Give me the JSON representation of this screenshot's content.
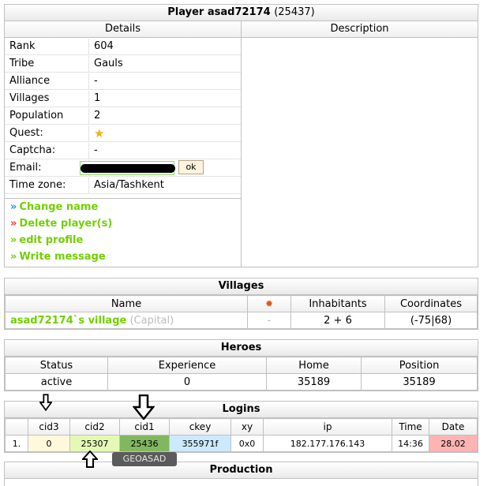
{
  "player": {
    "title": "Player asad72174",
    "id_text": "(25437)",
    "details_header": "Details",
    "description_header": "Description",
    "rows": [
      {
        "label": "Rank",
        "value": "604"
      },
      {
        "label": "Tribe",
        "value": "Gauls"
      },
      {
        "label": "Alliance",
        "value": "-"
      },
      {
        "label": "Villages",
        "value": "1"
      },
      {
        "label": "Population",
        "value": "2"
      },
      {
        "label": "Quest:",
        "value": ""
      },
      {
        "label": "Captcha:",
        "value": "-"
      },
      {
        "label": "Email:",
        "value": ""
      },
      {
        "label": "Time zone:",
        "value": "Asia/Tashkent"
      }
    ],
    "email_button": "ok",
    "links": [
      {
        "arrow": "»",
        "label": "Change name"
      },
      {
        "arrow": "»",
        "label": "Delete player(s)"
      },
      {
        "arrow": "»",
        "label": "edit profile"
      },
      {
        "arrow": "»",
        "label": "Write message"
      }
    ],
    "quest_icon": "star-icon",
    "colors": {
      "link_green": "#71d000",
      "arrow_blue": "#1f9bd6",
      "arrow_red": "#e33333"
    }
  },
  "villages": {
    "title": "Villages",
    "headers": {
      "name": "Name",
      "inhabitants": "Inhabitants",
      "coordinates": "Coordinates"
    },
    "header_icon": "explosion-icon",
    "rows": [
      {
        "name": "asad72174`s village",
        "tag": "(Capital)",
        "icon_value": "-",
        "inhabitants": "2 + 6",
        "coordinates": "(-75|68)"
      }
    ]
  },
  "heroes": {
    "title": "Heroes",
    "headers": {
      "status": "Status",
      "experience": "Experience",
      "home": "Home",
      "position": "Position"
    },
    "rows": [
      {
        "status": "active",
        "experience": "0",
        "home": "35189",
        "position": "35189"
      }
    ]
  },
  "logins": {
    "title": "Logins",
    "headers": {
      "cid3": "cid3",
      "cid2": "cid2",
      "cid1": "cid1",
      "ckey": "ckey",
      "xy": "xy",
      "ip": "ip",
      "time": "Time",
      "date": "Date"
    },
    "rows": [
      {
        "num": "1.",
        "cid3": "0",
        "cid2": "25307",
        "cid1": "25436",
        "ckey": "355971f",
        "xy": "0x0",
        "ip": "182.177.176.143",
        "time": "14:36",
        "date": "28.02"
      }
    ],
    "colors": {
      "cid3": "#fff8dc",
      "cid2": "#e4f9b6",
      "cid1": "#82b760",
      "ckey": "#cde9ff",
      "date": "#ffb4b4"
    }
  },
  "tooltip": "GEOASAD",
  "production": {
    "title": "Production"
  }
}
